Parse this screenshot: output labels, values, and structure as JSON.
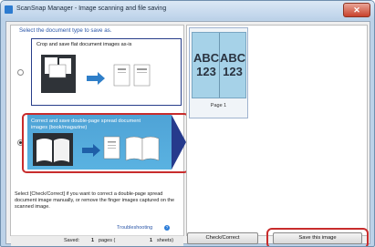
{
  "window": {
    "title": "ScanSnap Manager - Image scanning and file saving",
    "close_glyph": "✕"
  },
  "left": {
    "header": "Select the document type to save as.",
    "option1": {
      "label": "Crop and save flat document images as-is"
    },
    "option2": {
      "label": "Correct and save double-page spread document images (book/magazine)"
    },
    "description": "Select [Check/Correct] if you want to correct a double-page spread document image manually, or remove the finger images captured on the scanned image.",
    "troubleshooting": "Troubleshooting",
    "help_glyph": "?",
    "saved": {
      "label": "Saved:",
      "pages_value": "1",
      "pages_unit": "pages (",
      "sheets_value": "1",
      "sheets_unit": "sheets)"
    }
  },
  "preview": {
    "left_text": "ABC 123",
    "right_text": "ABC 123",
    "page_label": "Page 1"
  },
  "buttons": {
    "check": "Check/Correct",
    "save": "Save this image"
  }
}
